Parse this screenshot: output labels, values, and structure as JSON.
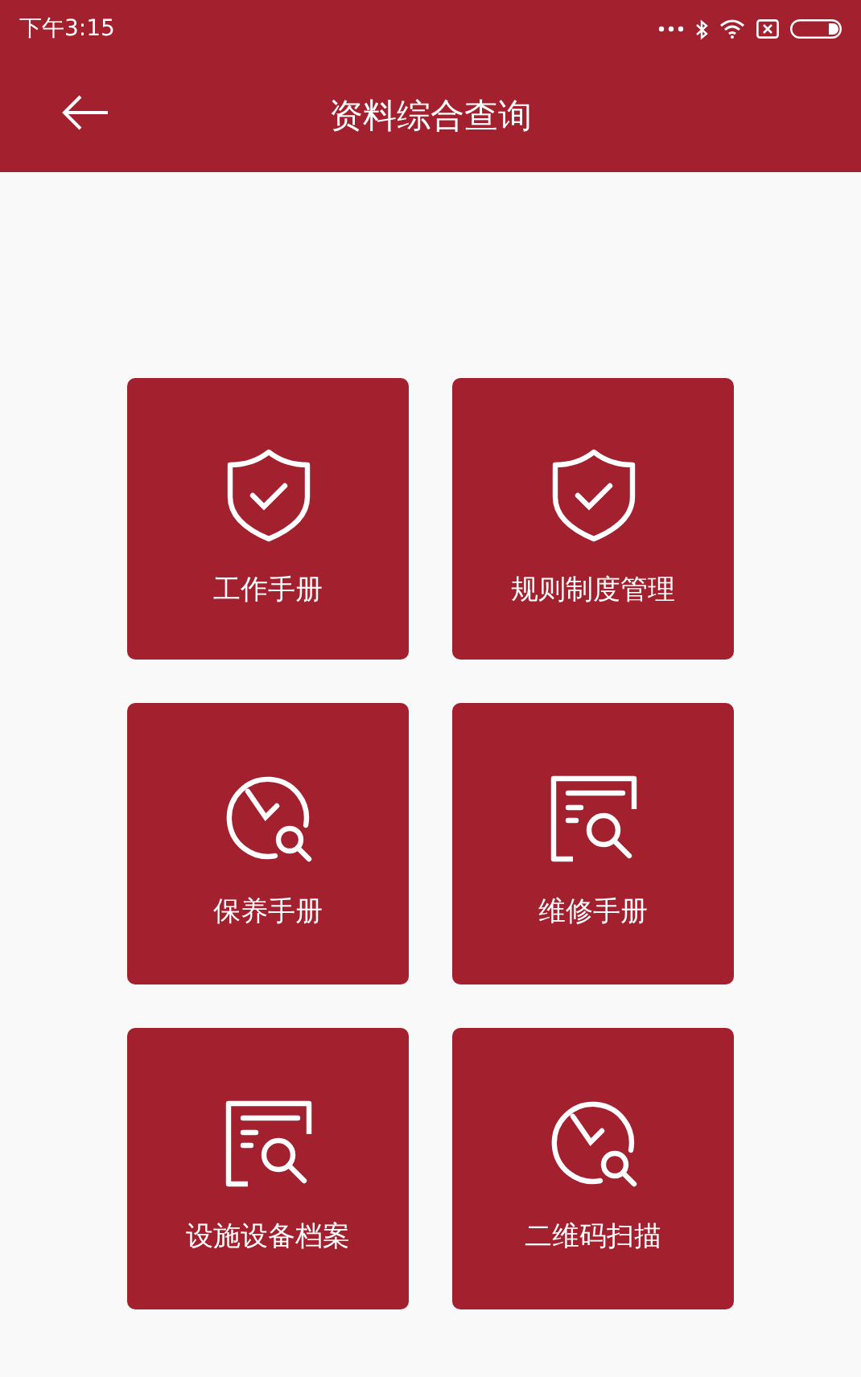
{
  "status_bar": {
    "time": "下午3:15"
  },
  "header": {
    "title": "资料综合查询"
  },
  "tiles": [
    {
      "label": "工作手册",
      "kind": "shield"
    },
    {
      "label": "规则制度管理",
      "kind": "shield"
    },
    {
      "label": "保养手册",
      "kind": "clock"
    },
    {
      "label": "维修手册",
      "kind": "document"
    },
    {
      "label": "设施设备档案",
      "kind": "document"
    },
    {
      "label": "二维码扫描",
      "kind": "clock"
    }
  ]
}
